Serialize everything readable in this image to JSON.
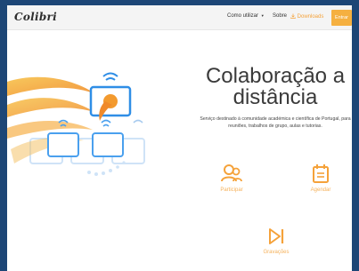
{
  "brand": {
    "logo": "Colibri"
  },
  "nav": {
    "items": [
      {
        "label": "Como utilizar",
        "caret": "▼"
      },
      {
        "label": "Sobre"
      },
      {
        "label": "Downloads",
        "icon": "download-icon"
      }
    ],
    "entrar_label": "Entrar"
  },
  "hero": {
    "title": "Colaboração a distância",
    "subtitle": "Serviço destinado à comunidade académica e científica de Portugal, para reuniões, trabalhos de grupo, aulas e tutorias."
  },
  "features": [
    {
      "label": "Participar",
      "icon": "users-icon"
    },
    {
      "label": "Agendar",
      "icon": "calendar-icon"
    },
    {
      "label": "Gravações",
      "icon": "play-next-icon"
    }
  ],
  "colors": {
    "background": "#1d4676",
    "accent": "#f5b040",
    "feature_icon": "#f5a23a",
    "hero_blue": "#2f8ee6"
  }
}
